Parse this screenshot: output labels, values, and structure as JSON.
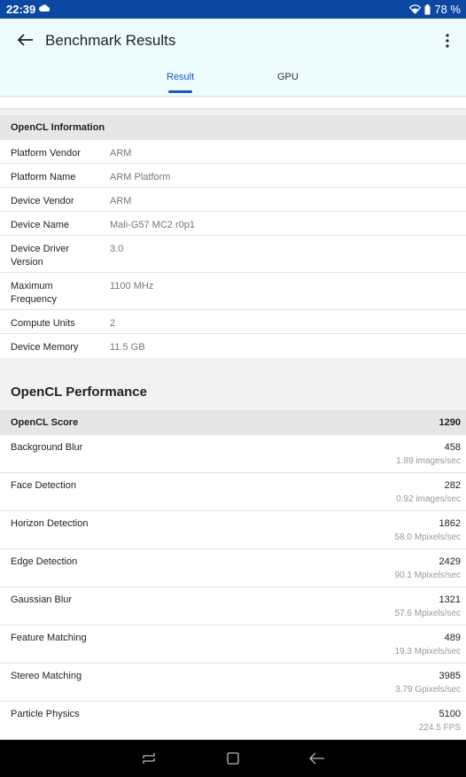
{
  "status": {
    "time": "22:39",
    "battery": "78 %"
  },
  "appbar": {
    "title": "Benchmark Results"
  },
  "tabs": [
    {
      "label": "Result"
    },
    {
      "label": "GPU"
    }
  ],
  "opencl_info": {
    "header": "OpenCL Information",
    "rows": [
      {
        "key": "Platform Vendor",
        "value": "ARM"
      },
      {
        "key": "Platform Name",
        "value": "ARM Platform"
      },
      {
        "key": "Device Vendor",
        "value": "ARM"
      },
      {
        "key": "Device Name",
        "value": "Mali-G57 MC2 r0p1"
      },
      {
        "key": "Device Driver Version",
        "value": "3.0"
      },
      {
        "key": "Maximum Frequency",
        "value": "1100 MHz"
      },
      {
        "key": "Compute Units",
        "value": "2"
      },
      {
        "key": "Device Memory",
        "value": "11.5 GB"
      }
    ]
  },
  "opencl_perf": {
    "title": "OpenCL Performance",
    "score_label": "OpenCL Score",
    "score_value": "1290",
    "rows": [
      {
        "name": "Background Blur",
        "score": "458",
        "unit": "1.89 images/sec"
      },
      {
        "name": "Face Detection",
        "score": "282",
        "unit": "0.92 images/sec"
      },
      {
        "name": "Horizon Detection",
        "score": "1862",
        "unit": "58.0 Mpixels/sec"
      },
      {
        "name": "Edge Detection",
        "score": "2429",
        "unit": "90.1 Mpixels/sec"
      },
      {
        "name": "Gaussian Blur",
        "score": "1321",
        "unit": "57.6 Mpixels/sec"
      },
      {
        "name": "Feature Matching",
        "score": "489",
        "unit": "19.3 Mpixels/sec"
      },
      {
        "name": "Stereo Matching",
        "score": "3985",
        "unit": "3.79 Gpixels/sec"
      },
      {
        "name": "Particle Physics",
        "score": "5100",
        "unit": "224.5 FPS"
      }
    ]
  }
}
